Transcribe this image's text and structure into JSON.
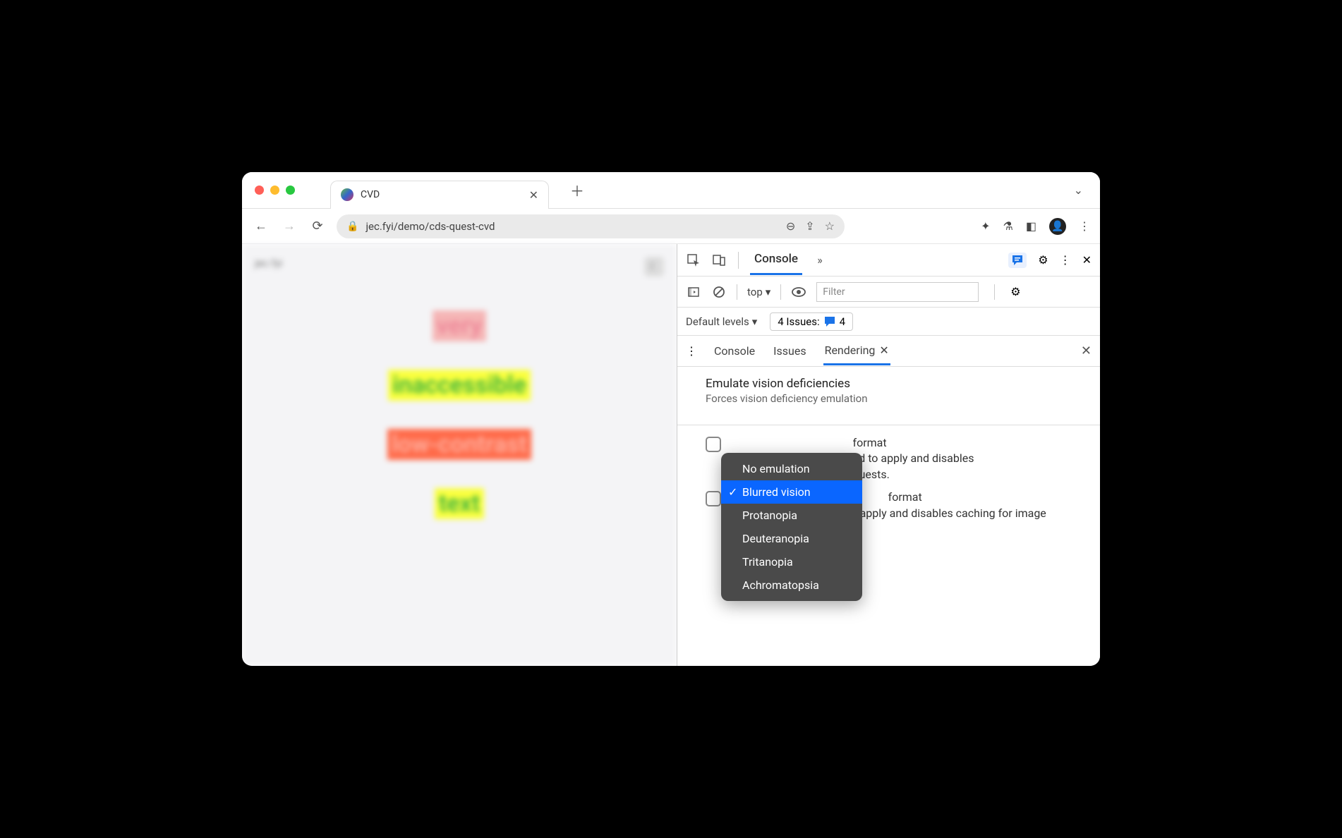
{
  "tab": {
    "title": "CVD"
  },
  "url": "jec.fyi/demo/cds-quest-cvd",
  "page": {
    "brand": "jec.fyi",
    "words": [
      "very",
      "inaccessible",
      "low-contrast",
      "text"
    ]
  },
  "devtools": {
    "mainTab": "Console",
    "context": "top",
    "filter_placeholder": "Filter",
    "levels_label": "Default levels",
    "issues_label": "4 Issues:",
    "issues_count": "4",
    "drawer": {
      "tabs": [
        "Console",
        "Issues",
        "Rendering"
      ]
    },
    "rendering": {
      "title": "Emulate vision deficiencies",
      "subtitle": "Forces vision deficiency emulation",
      "fmt1_title_tail": "format",
      "fmt1_body_tail": "ad to apply and disables",
      "fmt1_body_tail2": "quests.",
      "fmt2_title_tail": " format",
      "fmt2_body": "Requires a page reload to apply and disables caching for image requests."
    },
    "dropdown": {
      "items": [
        "No emulation",
        "Blurred vision",
        "Protanopia",
        "Deuteranopia",
        "Tritanopia",
        "Achromatopsia"
      ],
      "selected": "Blurred vision"
    }
  }
}
